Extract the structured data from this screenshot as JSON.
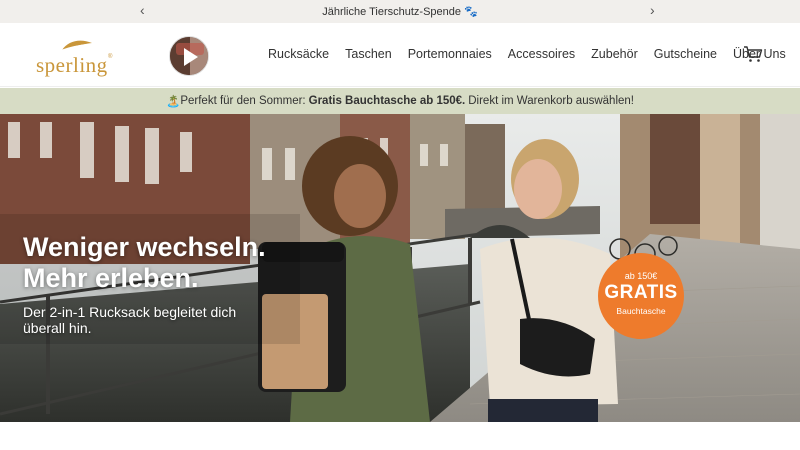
{
  "announcement": {
    "text": "Jährliche Tierschutz-Spende 🐾",
    "prev_icon": "chevron-left-icon",
    "next_icon": "chevron-right-icon"
  },
  "header": {
    "logo_text": "sperling",
    "logo_reg": "®",
    "nav": [
      {
        "label": "Rucksäcke"
      },
      {
        "label": "Taschen"
      },
      {
        "label": "Portemonnaies"
      },
      {
        "label": "Accessoires"
      },
      {
        "label": "Zubehör"
      },
      {
        "label": "Gutscheine"
      },
      {
        "label": "Über Uns"
      }
    ],
    "cart_icon": "shopping-cart-icon",
    "video_icon": "play-icon"
  },
  "promo": {
    "emoji": "🏝️",
    "before": "Perfekt für den Sommer:",
    "bold": "Gratis Bauchtasche ab 150€.",
    "after": "Direkt im Warenkorb auswählen!"
  },
  "hero": {
    "title_line1": "Weniger wechseln.",
    "title_line2": "Mehr erleben.",
    "subtitle": "Der 2-in-1 Rucksack begleitet dich überall hin.",
    "badge": {
      "line1": "ab 150€",
      "line2": "GRATIS",
      "line3": "Bauchtasche"
    }
  },
  "colors": {
    "brand_gold": "#c9963a",
    "promo_bg": "#d7dcc5",
    "badge_orange": "#ee7b2c",
    "announce_bg": "#f1efec"
  }
}
